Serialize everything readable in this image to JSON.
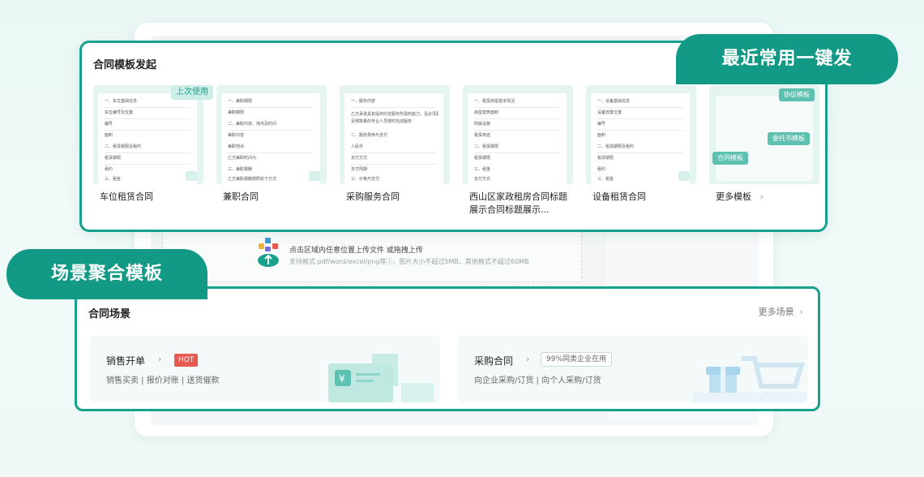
{
  "banners": {
    "recent": "最近常用一键发",
    "scene": "场景聚合模板"
  },
  "templates": {
    "title": "合同模板发起",
    "last_used_badge": "上次使用",
    "cards": [
      {
        "label": "车位租赁合同",
        "lines": [
          "一、车位基础信息",
          "车位编号及位置",
          "编号",
          "面积",
          "二、租赁期限及租约",
          "租赁期限",
          "租约",
          "三、租金"
        ]
      },
      {
        "label": "兼职合同",
        "lines": [
          "一、兼职期限",
          "兼职期限",
          "二、兼职内容、地点及时间",
          "兼职内容",
          "兼职地点",
          "乙方兼职时间为",
          "三、兼职报酬",
          "乙方兼职报酬按照如下方式"
        ]
      },
      {
        "label": "采购服务合同",
        "lines": [
          "一、服务内容",
          "乙方承诺具有提供约定服务所需的能力，且必须具备",
          "足够数量的专业人员按时完成服务",
          "二、服务费用与支付",
          "人民币",
          "支付方式",
          "支付周期",
          "三、价格与支付"
        ]
      },
      {
        "label": "西山区家政租房合同标题展示合同标题展示...",
        "lines": [
          "一、租赁房屋基本情况",
          "房屋建筑面积",
          "附属设施",
          "租赁用途",
          "二、租赁期限",
          "租赁期限",
          "三、租金",
          "支付方式"
        ]
      },
      {
        "label": "设备租赁合同",
        "lines": [
          "一、设备基础信息",
          "设备放置位置",
          "编号",
          "面积",
          "二、租赁期限及租约",
          "租赁期限",
          "租约",
          "三、租金"
        ]
      }
    ],
    "more_label": "更多模板",
    "more_pills": [
      "协议模板",
      "委托书模板",
      "合同模板"
    ]
  },
  "upload": {
    "title": "点击区域内任意位置上传文件 或拖拽上传",
    "subtitle": "支持格式 pdf/word/excel/png等ⓘ，图片大小不超过5MB，其他格式不超过60MB"
  },
  "scenes": {
    "title": "合同场景",
    "more_label": "更多场景",
    "cards": [
      {
        "title": "销售开单",
        "badge": "HOT",
        "subtitle": "销售买卖 | 报价对账 | 送货催款"
      },
      {
        "title": "采购合同",
        "badge": "99%同类企业在用",
        "subtitle": "向企业采购/订货 | 向个人采购/订货"
      }
    ]
  },
  "colors": {
    "brand": "#17a08c",
    "banner": "#129a86",
    "hot": "#e65a4f"
  }
}
